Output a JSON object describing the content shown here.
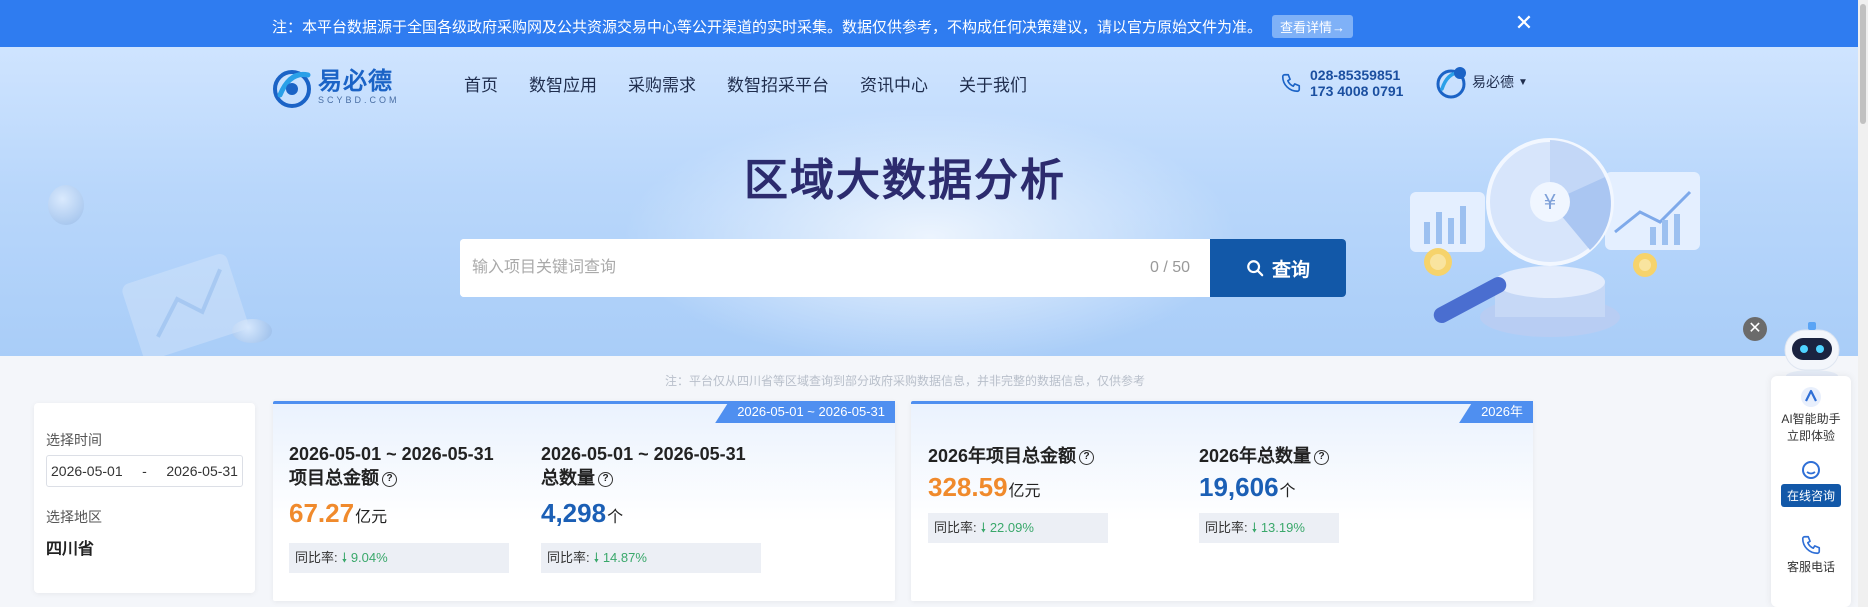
{
  "notice": {
    "text": "注：本平台数据源于全国各级政府采购网及公共资源交易中心等公开渠道的实时采集。数据仅供参考，不构成任何决策建议，请以官方原始文件为准。",
    "detail_label": "查看详情→",
    "close_icon": "close-icon"
  },
  "header": {
    "logo_cn": "易必德",
    "logo_en": "SCYBD.COM",
    "nav": [
      "首页",
      "数智应用",
      "采购需求",
      "数智招采平台",
      "资讯中心",
      "关于我们"
    ],
    "phone1": "028-85359851",
    "phone2": "173 4008 0791",
    "user_name": "易必德"
  },
  "hero": {
    "title": "区域大数据分析",
    "search_placeholder": "输入项目关键词查询",
    "search_count": "0 / 50",
    "search_button": "查询"
  },
  "note": "注：平台仅从四川省等区域查询到部分政府采购数据信息，并非完整的数据信息，仅供参考",
  "filter": {
    "time_label": "选择时间",
    "date_start": "2026-05-01",
    "date_sep": "-",
    "date_end": "2026-05-31",
    "region_label": "选择地区",
    "region_value": "四川省"
  },
  "card_range": {
    "tag": "2026-05-01 ~ 2026-05-31",
    "amount": {
      "title_line1": "2026-05-01 ~ 2026-05-31",
      "title_line2": "项目总金额",
      "value": "67.27",
      "unit": "亿元",
      "yoy_label": "同比率:",
      "yoy_value": "9.04%"
    },
    "count": {
      "title_line1": "2026-05-01 ~ 2026-05-31",
      "title_line2": "总数量",
      "value": "4,298",
      "unit": "个",
      "yoy_label": "同比率:",
      "yoy_value": "14.87%"
    }
  },
  "card_year": {
    "tag": "2026年",
    "amount": {
      "title": "2026年项目总金额",
      "value": "328.59",
      "unit": "亿元",
      "yoy_label": "同比率:",
      "yoy_value": "22.09%"
    },
    "count": {
      "title": "2026年总数量",
      "value": "19,606",
      "unit": "个",
      "yoy_label": "同比率:",
      "yoy_value": "13.19%"
    }
  },
  "float_bar": {
    "ai_line1": "AI智能助手",
    "ai_line2": "立即体验",
    "online": "在线咨询",
    "phone": "客服电话"
  },
  "colors": {
    "notice_bg": "#2f7cf0",
    "primary": "#1258a8",
    "amount": "#f08a2c",
    "count": "#1b5fb5",
    "yoy_green": "#3aa86b"
  }
}
